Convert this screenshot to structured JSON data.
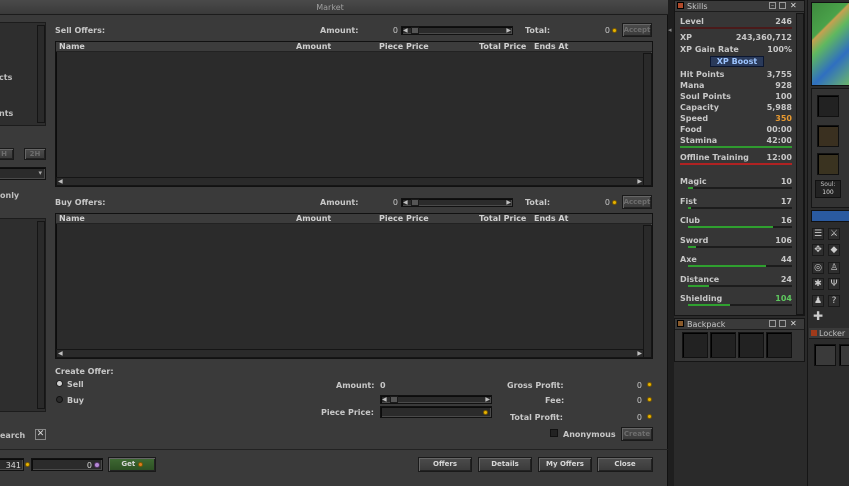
{
  "market": {
    "title": "Market",
    "sell": {
      "label": "Sell Offers:",
      "amount_label": "Amount:",
      "amount_value": "0",
      "total_label": "Total:",
      "total_value": "0",
      "accept_label": "Accept"
    },
    "buy": {
      "label": "Buy Offers:",
      "amount_label": "Amount:",
      "amount_value": "0",
      "total_label": "Total:",
      "total_value": "0",
      "accept_label": "Accept"
    },
    "columns": [
      "Name",
      "Amount",
      "Piece Price",
      "Total Price",
      "Ends At"
    ],
    "create": {
      "title": "Create Offer:",
      "sell_label": "Sell",
      "buy_label": "Buy",
      "amount_label": "Amount:",
      "amount_value": "0",
      "piece_price_label": "Piece Price:",
      "gross_profit_label": "Gross Profit:",
      "gross_profit_value": "0",
      "fee_label": "Fee:",
      "fee_value": "0",
      "total_profit_label": "Total Profit:",
      "total_profit_value": "0",
      "anonymous_label": "Anonymous",
      "create_label": "Create"
    },
    "left": {
      "frag_cts": "cts",
      "frag_nts": "nts",
      "frag_h": "H",
      "frag_2h": "2H",
      "frag_only": "only",
      "search_frag": "earch",
      "balance_frag": "341",
      "coins_value": "0"
    },
    "footer": {
      "get_label": "Get",
      "offers_label": "Offers",
      "details_label": "Details",
      "my_offers_label": "My Offers",
      "close_label": "Close"
    }
  },
  "skills": {
    "title": "Skills",
    "rows": [
      {
        "label": "Level",
        "value": "246"
      },
      {
        "label": "XP",
        "value": "243,360,712"
      },
      {
        "label": "XP Gain Rate",
        "value": "100%"
      }
    ],
    "xp_boost": "XP Boost",
    "stats": [
      {
        "label": "Hit Points",
        "value": "3,755"
      },
      {
        "label": "Mana",
        "value": "928"
      },
      {
        "label": "Soul Points",
        "value": "100"
      },
      {
        "label": "Capacity",
        "value": "5,988"
      },
      {
        "label": "Speed",
        "value": "350"
      },
      {
        "label": "Food",
        "value": "00:00"
      },
      {
        "label": "Stamina",
        "value": "42:00"
      },
      {
        "label": "Offline Training",
        "value": "12:00"
      }
    ],
    "speed_color": "#e89a30",
    "shielding_color": "#5ec85e",
    "combat": [
      {
        "label": "Magic",
        "value": "10",
        "progress": 0.05
      },
      {
        "label": "Fist",
        "value": "17",
        "progress": 0.03
      },
      {
        "label": "Club",
        "value": "16",
        "progress": 0.82
      },
      {
        "label": "Sword",
        "value": "106",
        "progress": 0.08
      },
      {
        "label": "Axe",
        "value": "44",
        "progress": 0.75
      },
      {
        "label": "Distance",
        "value": "24",
        "progress": 0.2
      },
      {
        "label": "Shielding",
        "value": "104",
        "progress": 0.4
      }
    ]
  },
  "backpack": {
    "title": "Backpack"
  },
  "locker": {
    "title": "Locker",
    "soul_label": "Soul:",
    "soul_value": "100"
  }
}
